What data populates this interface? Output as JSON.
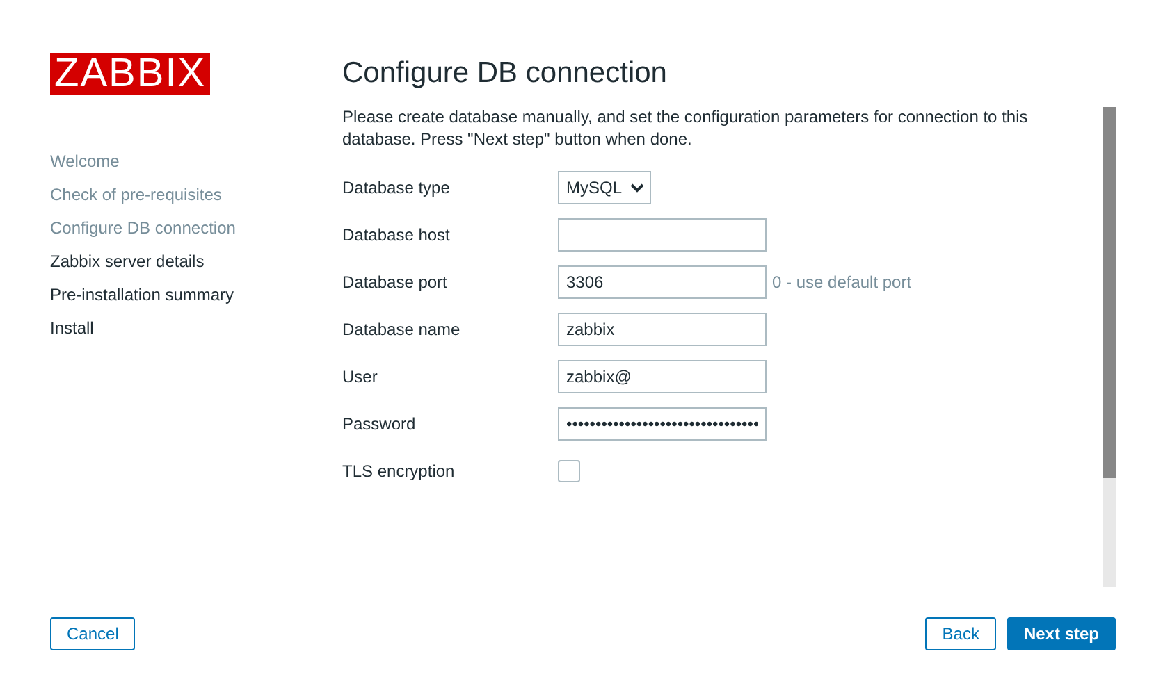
{
  "logo": "ZABBIX",
  "steps": [
    {
      "label": "Welcome",
      "done": true
    },
    {
      "label": "Check of pre-requisites",
      "done": true
    },
    {
      "label": "Configure DB connection",
      "done": true
    },
    {
      "label": "Zabbix server details",
      "done": false
    },
    {
      "label": "Pre-installation summary",
      "done": false
    },
    {
      "label": "Install",
      "done": false
    }
  ],
  "title": "Configure DB connection",
  "description": "Please create database manually, and set the configuration parameters for connection to this database. Press \"Next step\" button when done.",
  "fields": [
    {
      "kind": "select",
      "label": "Database type",
      "value": "MySQL"
    },
    {
      "kind": "text",
      "label": "Database host"
    },
    {
      "kind": "text",
      "label": "Database port",
      "value": "3306",
      "hint": "0 - use default port"
    },
    {
      "kind": "text",
      "label": "Database name",
      "value": "zabbix"
    },
    {
      "kind": "text",
      "label": "User",
      "value": "zabbix@"
    },
    {
      "kind": "text",
      "label": "Password",
      "value": "•••••••••••••••••••••••••••••••••"
    },
    {
      "kind": "checkbox",
      "label": "TLS encryption",
      "checked": false
    }
  ],
  "buttons": {
    "cancel": "Cancel",
    "back": "Back",
    "next": "Next step"
  }
}
